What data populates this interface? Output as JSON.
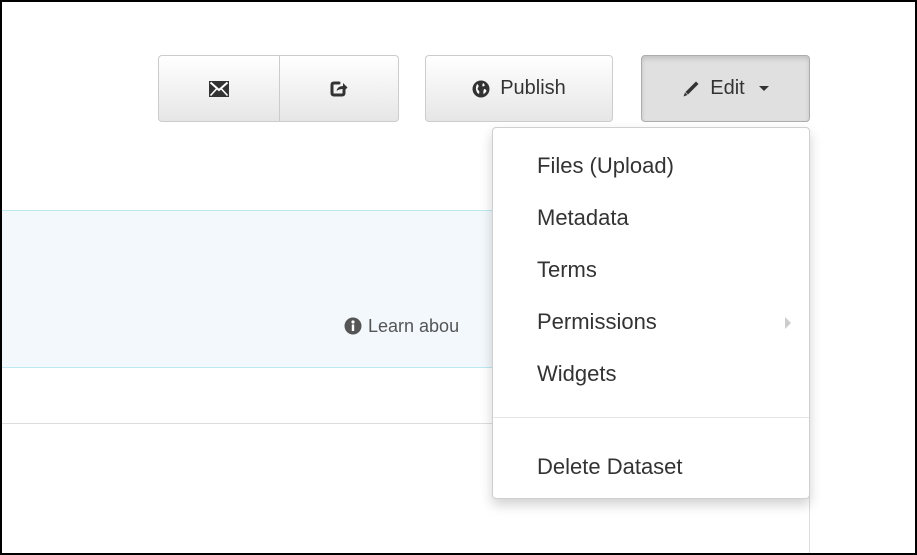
{
  "toolbar": {
    "email_icon": "envelope-icon",
    "share_icon": "share-icon",
    "publish_icon": "globe-icon",
    "publish_label": "Publish",
    "edit_icon": "pencil-icon",
    "edit_label": "Edit"
  },
  "alert": {
    "info_icon": "info-circle-icon",
    "link_text": "Learn abou"
  },
  "edit_menu": {
    "items": [
      {
        "label": "Files (Upload)"
      },
      {
        "label": "Metadata"
      },
      {
        "label": "Terms"
      },
      {
        "label": "Permissions",
        "has_submenu": true
      },
      {
        "label": "Widgets"
      }
    ],
    "delete_label": "Delete Dataset"
  },
  "colors": {
    "alert_background": "#f2f8fc",
    "alert_border": "#bce8f1",
    "button_border": "#cccccc",
    "text": "#333333"
  }
}
